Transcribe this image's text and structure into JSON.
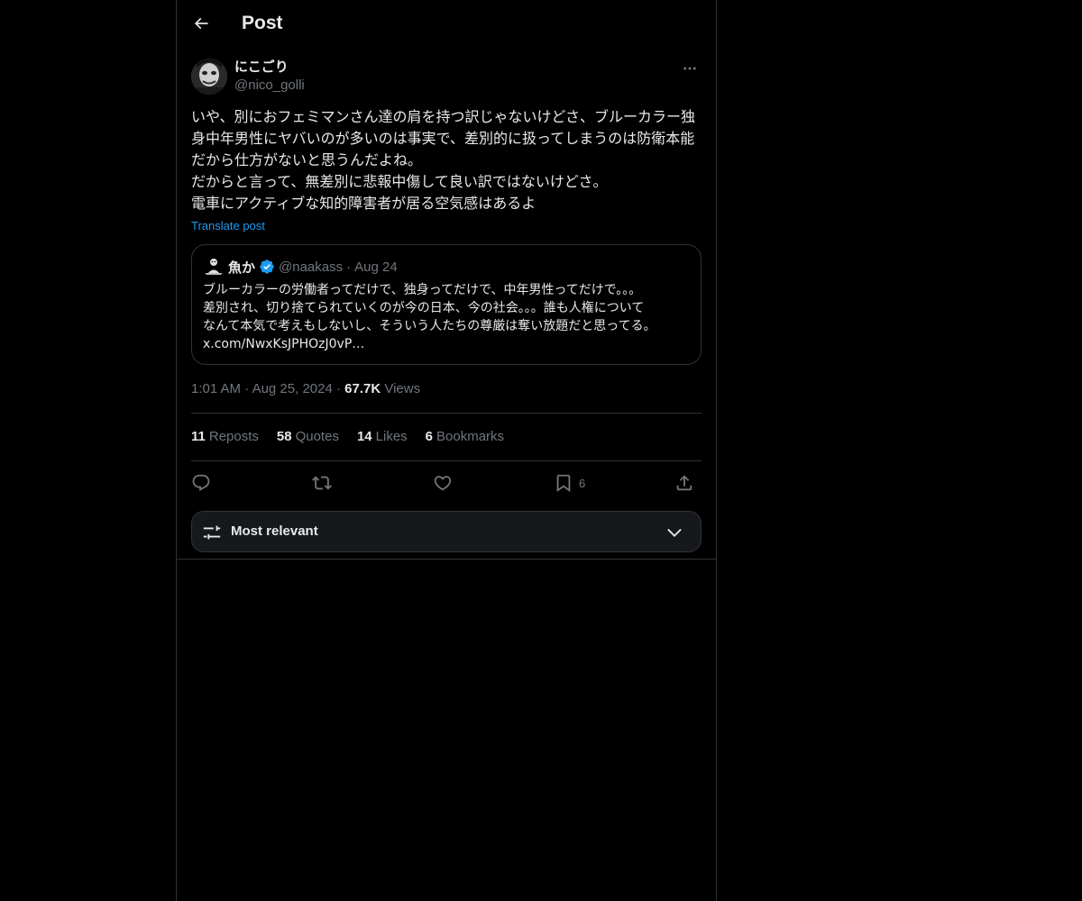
{
  "header": {
    "title": "Post"
  },
  "post": {
    "author_name": "にこごり",
    "author_handle": "@nico_golli",
    "text": "いや、別におフェミマンさん達の肩を持つ訳じゃないけどさ、ブルーカラー独身中年男性にヤバいのが多いのは事実で、差別的に扱ってしまうのは防衛本能だから仕方がないと思うんだよね。\nだからと言って、無差別に悲報中傷して良い訳ではないけどさ。\n電車にアクティブな知的障害者が居る空気感はあるよ",
    "translate_label": "Translate post",
    "time": "1:01 AM",
    "date": "Aug 25, 2024",
    "views_count": "67.7K",
    "views_label": "Views"
  },
  "quote": {
    "name": "魚か",
    "handle": "@naakass",
    "date": "Aug 24",
    "text": "ブルーカラーの労働者ってだけで、独身ってだけで、中年男性ってだけで。。。\n差別され、切り捨てられていくのが今の日本、今の社会。。。誰も人権について\nなんて本気で考えもしないし、そういう人たちの尊厳は奪い放題だと思ってる。\nx.com/NwxKsJPHOzJ0vP…"
  },
  "stats": {
    "reposts_count": "11",
    "reposts_label": "Reposts",
    "quotes_count": "58",
    "quotes_label": "Quotes",
    "likes_count": "14",
    "likes_label": "Likes",
    "bookmarks_count": "6",
    "bookmarks_label": "Bookmarks"
  },
  "actions": {
    "bookmark_count": "6"
  },
  "sort": {
    "label": "Most relevant"
  },
  "colors": {
    "background": "#000000",
    "text": "#e7e9ea",
    "muted": "#71767b",
    "accent": "#1d9bf0",
    "border": "#2f3336"
  }
}
